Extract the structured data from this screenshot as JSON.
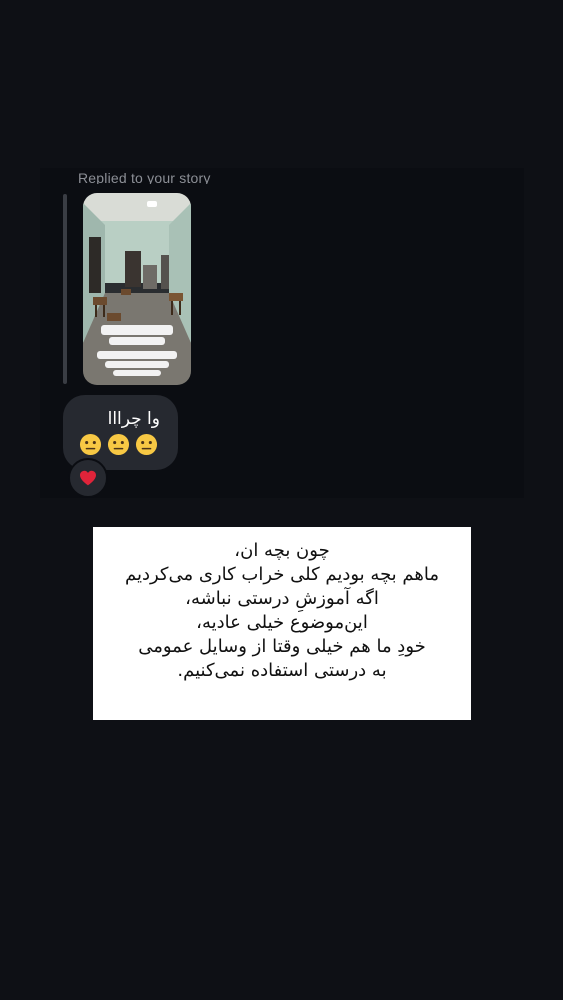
{
  "reply": {
    "label": "Replied to your story"
  },
  "message": {
    "text": "وا چرااا",
    "emojis": [
      "neutral-face",
      "neutral-face",
      "neutral-face"
    ],
    "reaction": "red-heart"
  },
  "caption": {
    "lines": [
      "چون بچه ان،",
      "ماهم بچه بودیم کلی خراب کاری می‌کردیم",
      "اگه آموزشِ درستی نباشه،",
      "این‌موضوع خیلی عادیه،",
      "خودِ ما هم خیلی وقتا از وسایل عمومی",
      "به درستی استفاده نمی‌کنیم."
    ]
  },
  "colors": {
    "background": "#0e1015",
    "bubble": "#262930",
    "caption_bg": "#ffffff",
    "heart": "#e0243a"
  }
}
